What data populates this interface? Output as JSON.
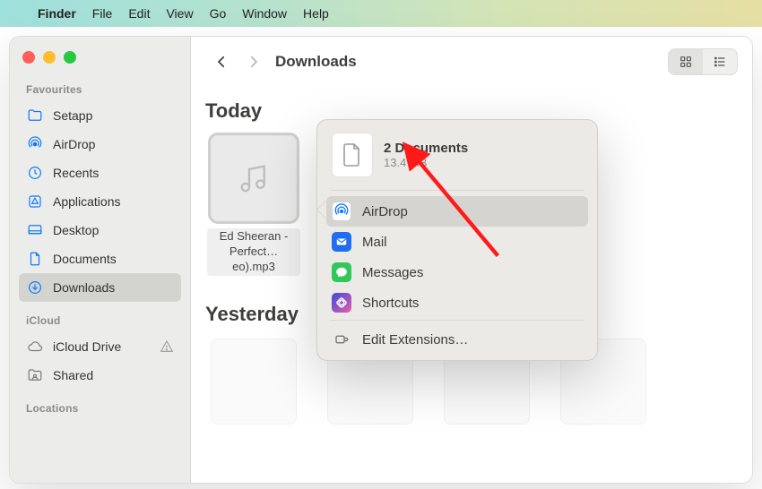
{
  "menubar": {
    "app": "Finder",
    "items": [
      "File",
      "Edit",
      "View",
      "Go",
      "Window",
      "Help"
    ]
  },
  "sidebar": {
    "sections": [
      {
        "title": "Favourites",
        "items": [
          {
            "icon": "folder",
            "label": "Setapp"
          },
          {
            "icon": "airdrop",
            "label": "AirDrop"
          },
          {
            "icon": "recents",
            "label": "Recents"
          },
          {
            "icon": "apps",
            "label": "Applications"
          },
          {
            "icon": "desktop",
            "label": "Desktop"
          },
          {
            "icon": "documents",
            "label": "Documents"
          },
          {
            "icon": "downloads",
            "label": "Downloads",
            "selected": true
          }
        ]
      },
      {
        "title": "iCloud",
        "items": [
          {
            "icon": "cloud",
            "label": "iCloud Drive",
            "warn": true
          },
          {
            "icon": "shared",
            "label": "Shared"
          }
        ]
      },
      {
        "title": "Locations",
        "items": []
      }
    ]
  },
  "toolbar": {
    "location": "Downloads"
  },
  "content": {
    "groups": [
      {
        "title": "Today",
        "items": [
          {
            "type": "audio",
            "name": "Ed Sheeran - Perfect…eo).mp3",
            "selected": true
          }
        ]
      },
      {
        "title": "Yesterday",
        "items": [
          {
            "type": "placeholder",
            "name": " "
          },
          {
            "type": "placeholder",
            "name": " "
          },
          {
            "type": "placeholder",
            "name": " "
          },
          {
            "type": "placeholder",
            "name": " "
          }
        ]
      }
    ]
  },
  "share_popover": {
    "title": "2 Documents",
    "subtitle": "13.4 MB",
    "options": [
      {
        "id": "airdrop",
        "label": "AirDrop",
        "hover": true
      },
      {
        "id": "mail",
        "label": "Mail"
      },
      {
        "id": "messages",
        "label": "Messages"
      },
      {
        "id": "shortcuts",
        "label": "Shortcuts"
      }
    ],
    "footer": "Edit Extensions…"
  }
}
